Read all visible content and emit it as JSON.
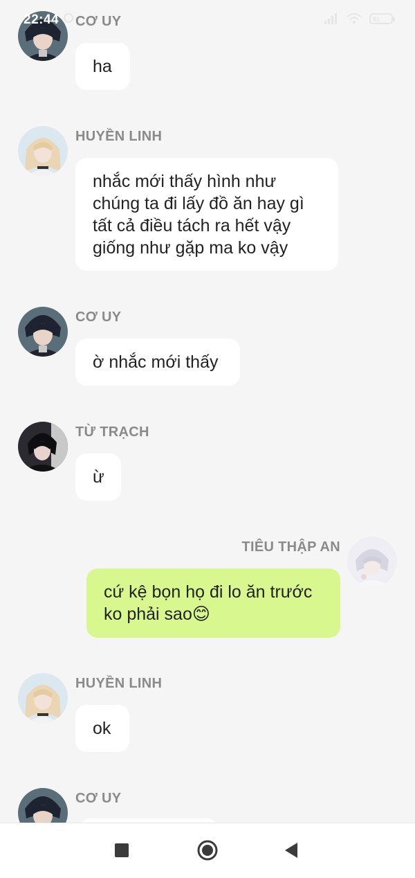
{
  "status_bar": {
    "time": "22:44",
    "battery": "81"
  },
  "messages": [
    {
      "sender": "CƠ UY",
      "text": "ha"
    },
    {
      "sender": "HUYỀN LINH",
      "lines": [
        "nhắc mới thấy hình như",
        "chúng ta đi lấy đồ ăn hay gì",
        "tất cả điều tách ra hết vậy",
        "giống như gặp ma ko vậy"
      ]
    },
    {
      "sender": "CƠ UY",
      "text": "ờ nhắc mới thấy"
    },
    {
      "sender": "TỪ TRẠCH",
      "text": "ừ"
    },
    {
      "sender": "TIÊU THẬP AN",
      "lines": [
        "cứ kệ bọn họ đi lo ăn trước",
        "ko phải sao😊"
      ],
      "mine": true
    },
    {
      "sender": "HUYỀN LINH",
      "text": "ok"
    },
    {
      "sender": "CƠ UY",
      "text": ""
    }
  ],
  "colors": {
    "my_bubble": "#d9f78f",
    "other_bubble": "#ffffff",
    "background": "#f5f5f5"
  },
  "nav": {
    "recent": "square-icon",
    "home": "circle-home-icon",
    "back": "triangle-back-icon"
  }
}
